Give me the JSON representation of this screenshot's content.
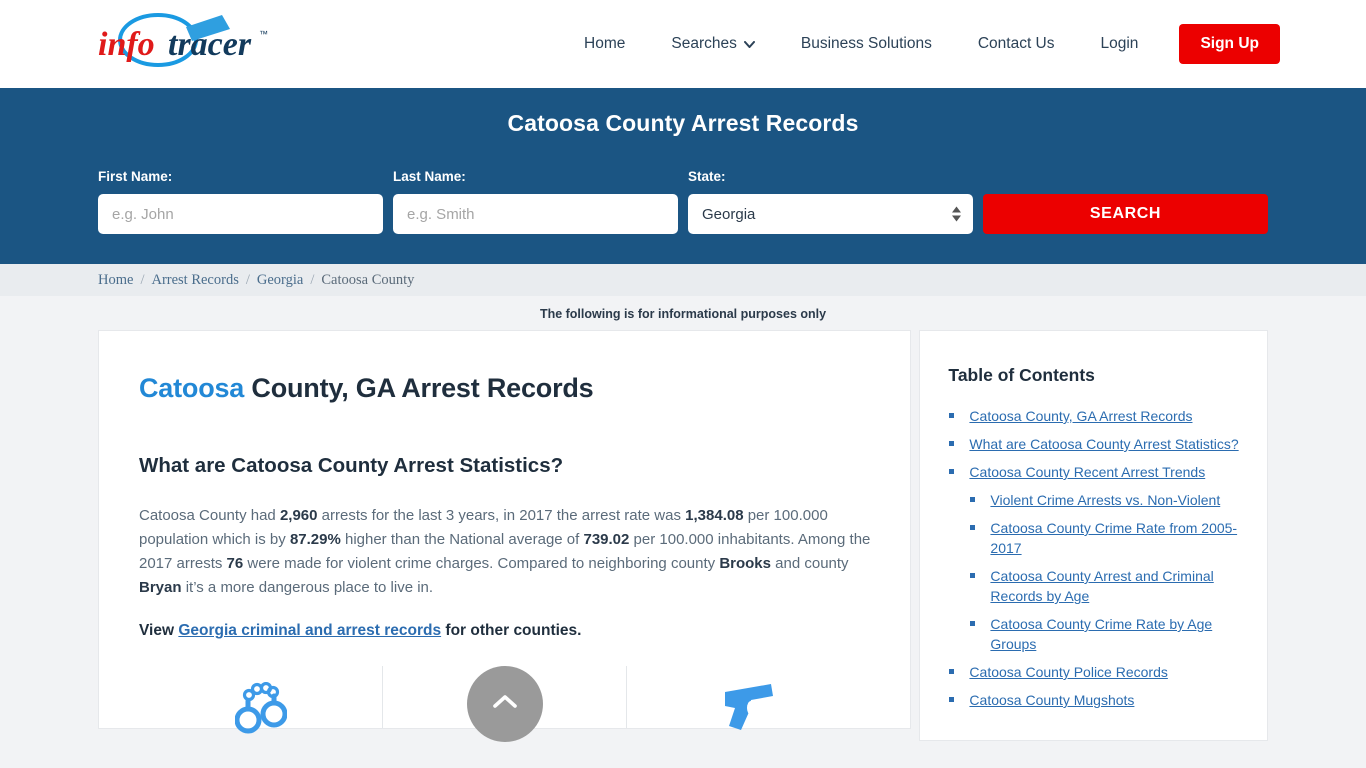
{
  "brand": {
    "name_info": "info",
    "name_tracer": "tracer",
    "tm": "™"
  },
  "nav": {
    "items": [
      {
        "label": "Home",
        "has_caret": false
      },
      {
        "label": "Searches",
        "has_caret": true
      },
      {
        "label": "Business Solutions",
        "has_caret": false
      },
      {
        "label": "Contact Us",
        "has_caret": false
      },
      {
        "label": "Login",
        "has_caret": false
      }
    ],
    "signup_label": "Sign Up",
    "signup_color": "#ec0000"
  },
  "search_band": {
    "title": "Catoosa County Arrest Records",
    "background": "#1b5583",
    "first_name_label": "First Name:",
    "first_name_placeholder": "e.g. John",
    "first_name_value": "",
    "last_name_label": "Last Name:",
    "last_name_placeholder": "e.g. Smith",
    "last_name_value": "",
    "state_label": "State:",
    "state_value": "Georgia",
    "state_options": [
      "Georgia"
    ],
    "search_label": "SEARCH"
  },
  "breadcrumb": {
    "items": [
      {
        "label": "Home",
        "current": false
      },
      {
        "label": "Arrest Records",
        "current": false
      },
      {
        "label": "Georgia",
        "current": false
      },
      {
        "label": "Catoosa County",
        "current": true
      }
    ],
    "separator": "/"
  },
  "notice": "The following is for informational purposes only",
  "main": {
    "title_highlight": "Catoosa",
    "title_rest": " County, GA Arrest Records",
    "section_title": "What are Catoosa County Arrest Statistics?",
    "paragraph1": {
      "p1": "Catoosa County had ",
      "b1": "2,960",
      "p2": " arrests for the last 3 years, in 2017 the arrest rate was ",
      "b2": "1,384.08",
      "p3": " per 100.000 population which is by ",
      "b3": "87.29%",
      "p4": " higher than the National average of ",
      "b4": "739.02",
      "p5": " per 100.000 inhabitants. Among the 2017 arrests ",
      "b5": "76",
      "p6": " were made for violent crime charges. Compared to neighboring county ",
      "b6": "Brooks",
      "p7": " and county ",
      "b7": "Bryan",
      "p8": " it’s a more dangerous place to live in."
    },
    "view_line": {
      "prefix": "View ",
      "link": "Georgia criminal and arrest records",
      "suffix": " for other counties."
    },
    "icons": [
      {
        "name": "handcuffs-icon",
        "color": "#3d9ae8"
      },
      {
        "name": "growth-chart-icon",
        "color": "#3d9ae8"
      },
      {
        "name": "gun-icon",
        "color": "#3d9ae8"
      }
    ],
    "scroll_top": {
      "name": "scroll-to-top-button",
      "color": "#9a9a9a"
    }
  },
  "toc": {
    "title": "Table of Contents",
    "items": [
      {
        "label": "Catoosa County, GA Arrest Records",
        "level": 1
      },
      {
        "label": "What are Catoosa County Arrest Statistics?",
        "level": 1
      },
      {
        "label": "Catoosa County Recent Arrest Trends",
        "level": 1
      },
      {
        "label": "Violent Crime Arrests vs. Non-Violent",
        "level": 2
      },
      {
        "label": "Catoosa County Crime Rate from 2005-2017",
        "level": 2
      },
      {
        "label": "Catoosa County Arrest and Criminal Records by Age",
        "level": 2
      },
      {
        "label": "Catoosa County Crime Rate by Age Groups",
        "level": 2
      },
      {
        "label": "Catoosa County Police Records",
        "level": 1
      },
      {
        "label": "Catoosa County Mugshots",
        "level": 1
      }
    ]
  }
}
